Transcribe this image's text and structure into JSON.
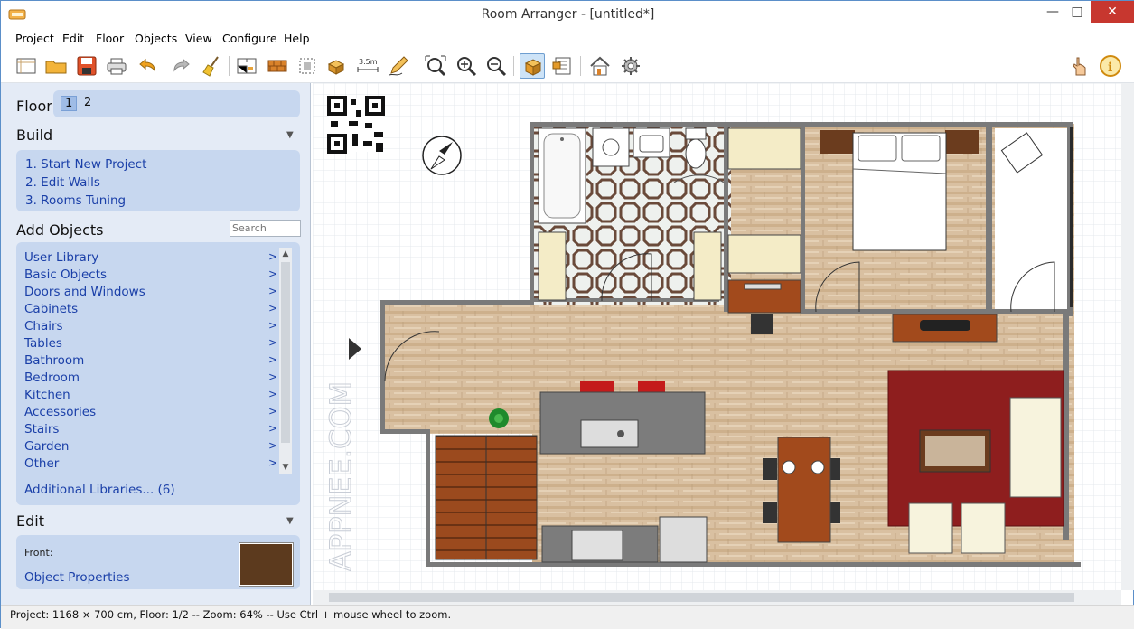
{
  "window": {
    "title": "Room Arranger - [untitled*]"
  },
  "menu": [
    "Project",
    "Edit",
    "Floor",
    "Objects",
    "View",
    "Configure",
    "Help"
  ],
  "toolbar": {
    "buttons": [
      "new-project",
      "open",
      "save",
      "print",
      "undo",
      "redo",
      "clean",
      "floor-plan",
      "wall",
      "resize",
      "object-3d",
      "measure",
      "pencil",
      "zoom-fit",
      "zoom-in",
      "zoom-out",
      "3d-box",
      "list",
      "house-3d",
      "settings"
    ],
    "right": [
      "hand-tool",
      "info"
    ]
  },
  "sidebar": {
    "floor": {
      "label": "Floor",
      "floors": [
        "1",
        "2"
      ],
      "selected": "1"
    },
    "build": {
      "label": "Build",
      "items": [
        "1. Start New Project",
        "2. Edit Walls",
        "3. Rooms Tuning"
      ]
    },
    "add_objects": {
      "label": "Add Objects",
      "search_placeholder": "Search",
      "items": [
        "User Library",
        "Basic Objects",
        "Doors and Windows",
        "Cabinets",
        "Chairs",
        "Tables",
        "Bathroom",
        "Bedroom",
        "Kitchen",
        "Accessories",
        "Stairs",
        "Garden",
        "Other"
      ],
      "arrow": ">",
      "additional": "Additional Libraries... (6)"
    },
    "edit": {
      "label": "Edit",
      "front_label": "Front:",
      "object_properties": "Object Properties",
      "front_color": "#5c3a1e"
    }
  },
  "canvas": {
    "watermark": "APPNEE.COM"
  },
  "status": "Project: 1168 × 700 cm, Floor: 1/2 -- Zoom: 64% -- Use Ctrl + mouse wheel to zoom."
}
